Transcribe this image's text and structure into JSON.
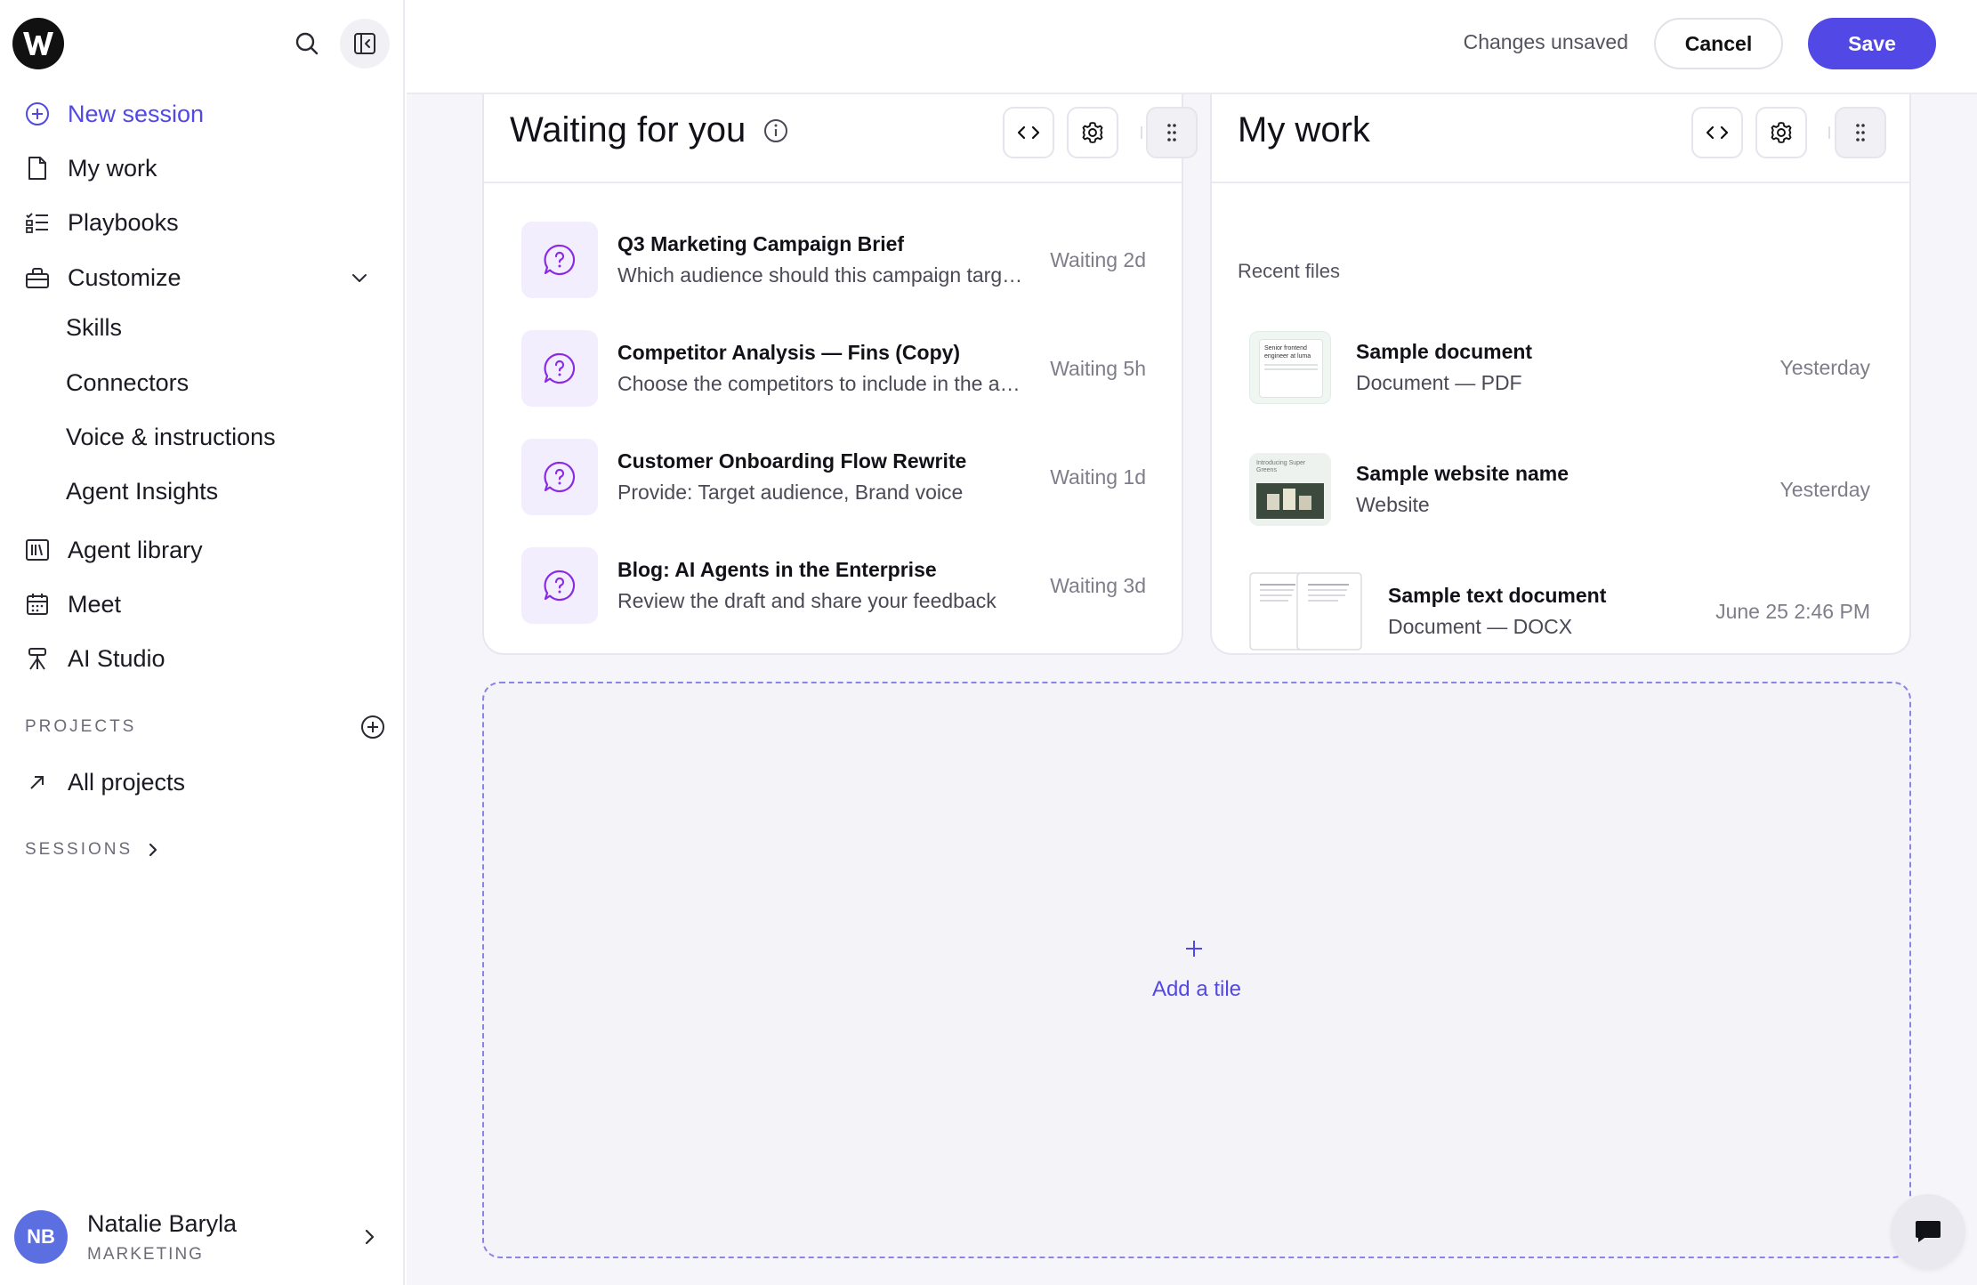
{
  "brand": {
    "logo_letter": "W",
    "accent": "#5148e6"
  },
  "sidebar": {
    "nav": [
      {
        "label": "New session",
        "icon": "plus-circle-icon"
      },
      {
        "label": "My work",
        "icon": "file-icon"
      },
      {
        "label": "Playbooks",
        "icon": "checklist-icon"
      },
      {
        "label": "Customize",
        "icon": "toolbox-icon"
      }
    ],
    "customize_sub": [
      "Skills",
      "Connectors",
      "Voice & instructions",
      "Agent Insights"
    ],
    "nav2": [
      {
        "label": "Agent library",
        "icon": "library-icon"
      },
      {
        "label": "Meet",
        "icon": "calendar-icon"
      },
      {
        "label": "AI Studio",
        "icon": "studio-icon"
      }
    ],
    "projects_label": "PROJECTS",
    "all_projects": "All projects",
    "sessions_label": "SESSIONS",
    "profile": {
      "initials": "NB",
      "name": "Natalie Baryla",
      "role": "MARKETING"
    }
  },
  "topbar": {
    "status": "Changes unsaved",
    "cancel": "Cancel",
    "save": "Save"
  },
  "waiting": {
    "title": "Waiting for you",
    "items": [
      {
        "title": "Q3 Marketing Campaign Brief",
        "desc": "Which audience should this campaign target?",
        "time": "Waiting 2d"
      },
      {
        "title": "Competitor Analysis — Fins (Copy)",
        "desc": "Choose the competitors to include in the analysis",
        "time": "Waiting 5h"
      },
      {
        "title": "Customer Onboarding Flow Rewrite",
        "desc": "Provide: Target audience, Brand voice",
        "time": "Waiting 1d"
      },
      {
        "title": "Blog: AI Agents in the Enterprise",
        "desc": "Review the draft and share your feedback",
        "time": "Waiting 3d"
      }
    ]
  },
  "mywork": {
    "title": "My work",
    "recent_label": "Recent files",
    "files": [
      {
        "name": "Sample document",
        "type": "Document — PDF",
        "date": "Yesterday",
        "thumb_text": "Senior frontend engineer at luma"
      },
      {
        "name": "Sample website name",
        "type": "Website",
        "date": "Yesterday",
        "thumb_text": "Introducing Super Greens"
      },
      {
        "name": "Sample text document",
        "type": "Document — DOCX",
        "date": "June 25 2:46 PM"
      }
    ]
  },
  "add_tile": {
    "label": "Add a tile"
  }
}
